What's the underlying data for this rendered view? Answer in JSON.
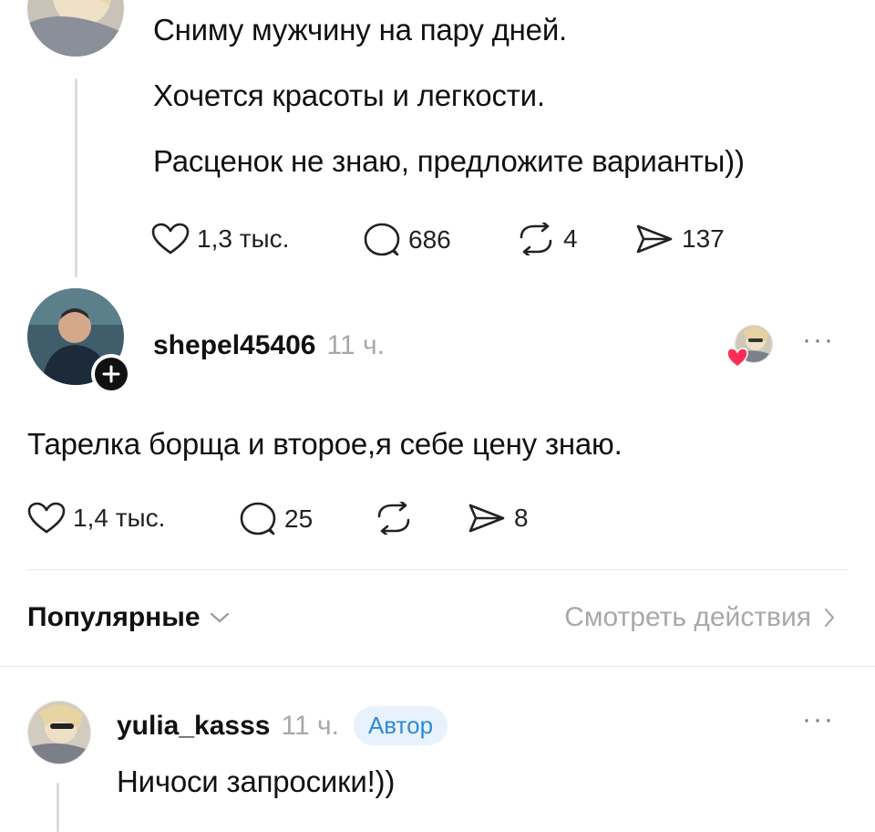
{
  "post": {
    "lines": [
      "Сниму мужчину на пару дней.",
      "Хочется красоты и легкости.",
      "Расценок не знаю, предложите варианты))"
    ],
    "likes": "1,3 тыс.",
    "comments": "686",
    "reposts": "4",
    "shares": "137"
  },
  "reply": {
    "username": "shepel45406",
    "time": "11 ч.",
    "text": "Тарелка борща и второе,я себе цену знаю.",
    "likes": "1,4 тыс.",
    "comments": "25",
    "shares": "8"
  },
  "sort_bar": {
    "sort_label": "Популярные",
    "activity_label": "Смотреть действия"
  },
  "comment": {
    "username": "yulia_kasss",
    "time": "11 ч.",
    "badge": "Автор",
    "text": "Ничоси запросики!))"
  },
  "colors": {
    "badge_bg": "#e8f2fd",
    "badge_text": "#2d8ad8",
    "like_heart": "#ff2d55",
    "muted": "#a8a8a8"
  },
  "icons": [
    "heart-icon",
    "comment-icon",
    "repost-icon",
    "share-icon",
    "plus-icon",
    "chevron-down-icon",
    "chevron-right-icon",
    "more-icon"
  ]
}
